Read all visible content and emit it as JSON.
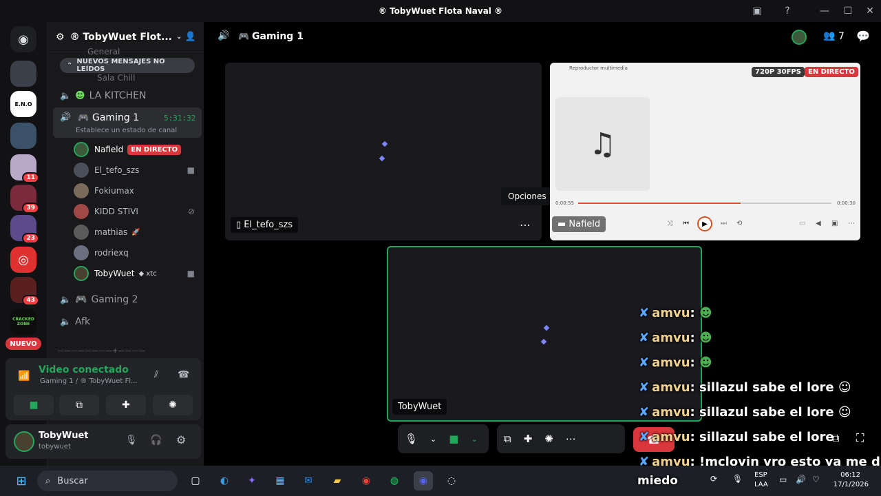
{
  "window": {
    "title": "® TobyWuet Flota Naval ®"
  },
  "servers": {
    "nuevo_label": "NUEVO",
    "badges": [
      "11",
      "39",
      "23",
      "43"
    ],
    "eno_label": "E.N.O",
    "cracked_label": "CRACKED ZONE"
  },
  "guild": {
    "name": "® TobyWuet Flot..."
  },
  "channel_list": {
    "new_messages_banner": "NUEVOS MENSAJES NO LEÍDOS",
    "partial_1": "General",
    "partial_2": "Sala Chill",
    "kitchen": "LA KITCHEN",
    "gaming1": "Gaming 1",
    "gaming1_timer": "5:31:32",
    "gaming1_status": "Establece un estado de canal",
    "gaming2": "Gaming 2",
    "afk": "Afk",
    "divider": "————————+————"
  },
  "members": [
    {
      "name": "Nafield",
      "live": "EN DIRECTO"
    },
    {
      "name": "El_tefo_szs"
    },
    {
      "name": "Fokiumax"
    },
    {
      "name": "KIDD STIVI"
    },
    {
      "name": "mathias"
    },
    {
      "name": "rodriexq"
    },
    {
      "name": "TobyWuet",
      "tag": "xtc"
    }
  ],
  "voice_panel": {
    "status": "Video conectado",
    "location": "Gaming 1 / ® TobyWuet Fl..."
  },
  "user_panel": {
    "display_name": "TobyWuet",
    "username": "tobywuet"
  },
  "header": {
    "channel": "Gaming 1",
    "member_count": "7"
  },
  "tiles": {
    "tefo_name": "El_tefo_szs",
    "options_tooltip": "Opciones",
    "nafield_name": "Nafield",
    "stream_quality": "720P 30FPS",
    "stream_live": "EN DIRECTO",
    "player_title": "Reproductor multimedia",
    "player_time_left": "0:00:55",
    "player_time_right": "0:00:30",
    "self_name": "TobyWuet"
  },
  "chat_overlay": [
    {
      "user": "amvu",
      "text": ""
    },
    {
      "user": "amvu",
      "text": ""
    },
    {
      "user": "amvu",
      "text": ""
    },
    {
      "user": "amvu",
      "text": "sillazul sabe el lore"
    },
    {
      "user": "amvu",
      "text": "sillazul sabe el lore"
    },
    {
      "user": "amvu",
      "text": "sillazul sabe el lore"
    },
    {
      "user": "amvu",
      "text": "!mclovin vro esto ya me dio"
    }
  ],
  "chat_tail": "miedo",
  "taskbar": {
    "search": "Buscar",
    "lang1": "ESP",
    "lang2": "LAA",
    "time": "06:12",
    "date": "17/1/2026"
  },
  "colors": {
    "accent_live": "#da373c",
    "voice_green": "#23a55a",
    "blurple": "#5865f2"
  }
}
